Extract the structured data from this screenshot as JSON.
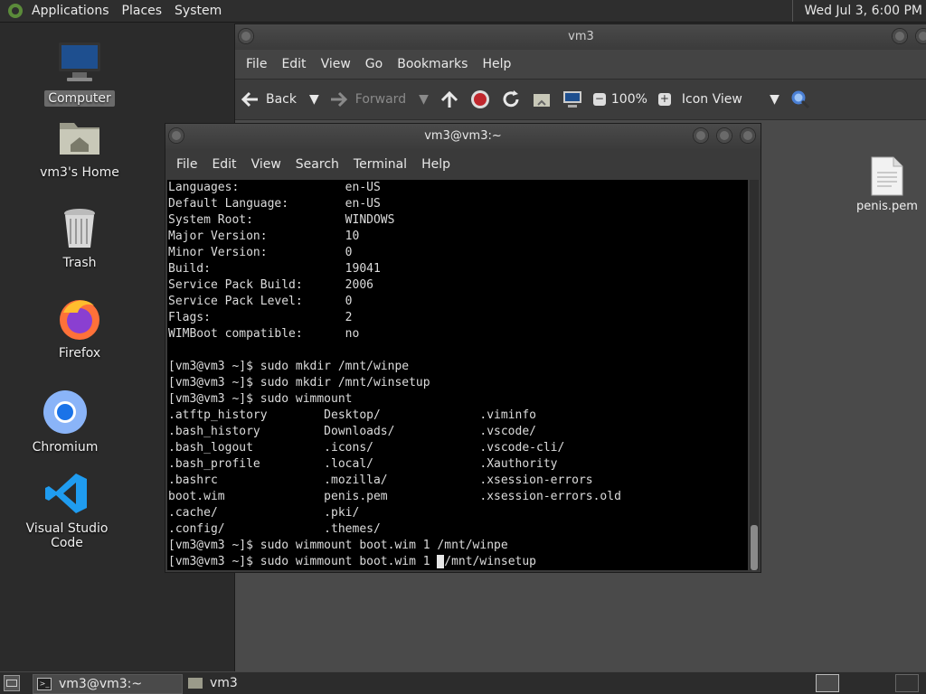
{
  "top_panel": {
    "menus": [
      "Applications",
      "Places",
      "System"
    ],
    "clock": "Wed Jul  3,  6:00 PM"
  },
  "desktop_icons": [
    {
      "label": "Computer",
      "icon": "computer-icon"
    },
    {
      "label": "vm3's Home",
      "icon": "home-folder-icon"
    },
    {
      "label": "Trash",
      "icon": "trash-icon"
    },
    {
      "label": "Firefox",
      "icon": "firefox-icon"
    },
    {
      "label": "Chromium",
      "icon": "chromium-icon"
    },
    {
      "label": "Visual Studio Code",
      "icon": "vscode-icon"
    }
  ],
  "file_manager": {
    "title": "vm3",
    "menus": [
      "File",
      "Edit",
      "View",
      "Go",
      "Bookmarks",
      "Help"
    ],
    "toolbar": {
      "back": "Back",
      "forward": "Forward",
      "zoom": "100%",
      "view_mode": "Icon View"
    },
    "files": [
      {
        "name": "penis.pem",
        "icon": "document-icon"
      }
    ]
  },
  "terminal": {
    "title": "vm3@vm3:~",
    "menus": [
      "File",
      "Edit",
      "View",
      "Search",
      "Terminal",
      "Help"
    ],
    "lines": [
      "Languages:               en-US",
      "Default Language:        en-US",
      "System Root:             WINDOWS",
      "Major Version:           10",
      "Minor Version:           0",
      "Build:                   19041",
      "Service Pack Build:      2006",
      "Service Pack Level:      0",
      "Flags:                   2",
      "WIMBoot compatible:      no",
      "",
      "[vm3@vm3 ~]$ sudo mkdir /mnt/winpe",
      "[vm3@vm3 ~]$ sudo mkdir /mnt/winsetup",
      "[vm3@vm3 ~]$ sudo wimmount",
      ".atftp_history        Desktop/              .viminfo",
      ".bash_history         Downloads/            .vscode/",
      ".bash_logout          .icons/               .vscode-cli/",
      ".bash_profile         .local/               .Xauthority",
      ".bashrc               .mozilla/             .xsession-errors",
      "boot.wim              penis.pem             .xsession-errors.old",
      ".cache/               .pki/",
      ".config/              .themes/",
      "[vm3@vm3 ~]$ sudo wimmount boot.wim 1 /mnt/winpe"
    ],
    "cursor_line_before": "[vm3@vm3 ~]$ sudo wimmount boot.wim 1",
    "cursor_line_after": "/mnt/winsetup"
  },
  "taskbar": {
    "tasks": [
      {
        "label": "vm3@vm3:~",
        "icon": "terminal-icon",
        "active": true
      },
      {
        "label": "vm3",
        "icon": "folder-icon",
        "active": false
      }
    ]
  }
}
